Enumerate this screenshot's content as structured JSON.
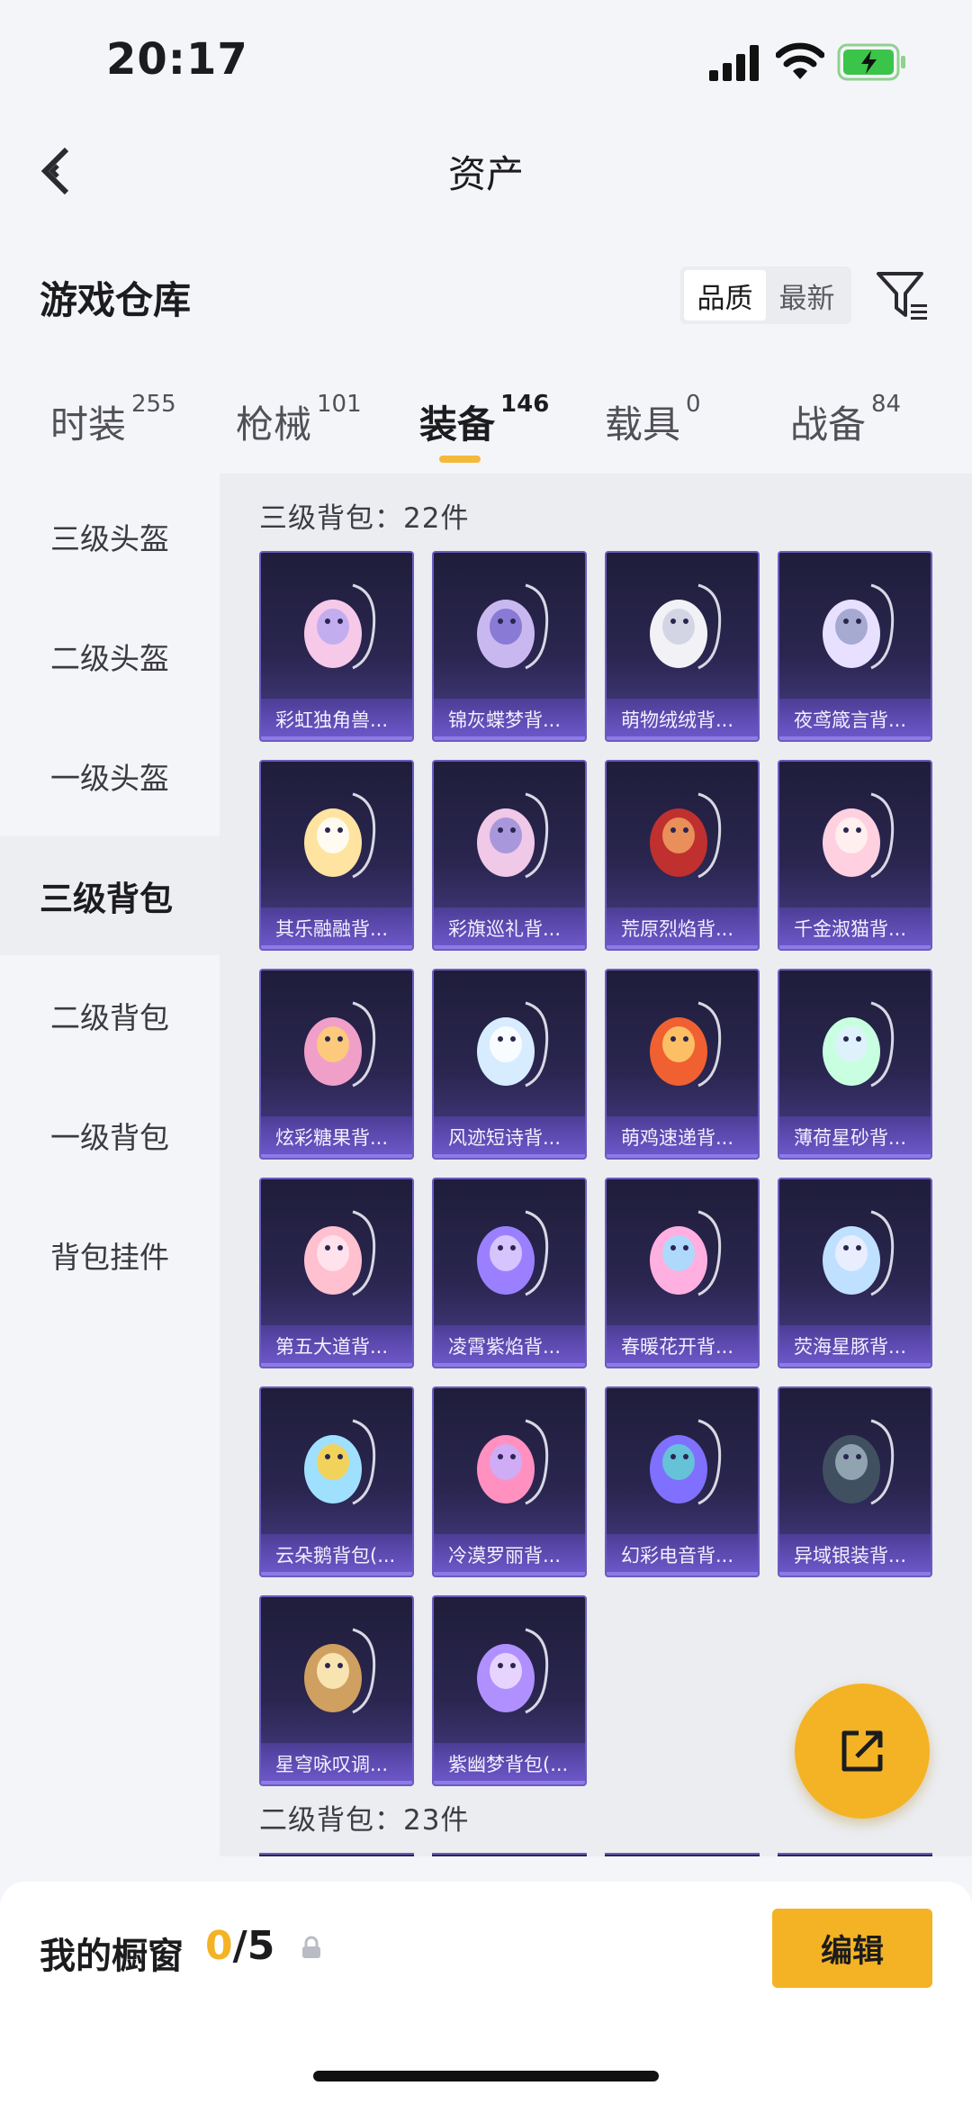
{
  "status": {
    "time": "20:17"
  },
  "nav": {
    "title": "资产"
  },
  "header": {
    "section_title": "游戏仓库",
    "sort_options": [
      "品质",
      "最新"
    ]
  },
  "tabs": [
    {
      "label": "时装",
      "count": "255"
    },
    {
      "label": "枪械",
      "count": "101"
    },
    {
      "label": "装备",
      "count": "146"
    },
    {
      "label": "载具",
      "count": "0"
    },
    {
      "label": "战备",
      "count": "84"
    }
  ],
  "sidebar": {
    "items": [
      "三级头盔",
      "二级头盔",
      "一级头盔",
      "三级背包",
      "二级背包",
      "一级背包",
      "背包挂件"
    ]
  },
  "groups": [
    {
      "title": "三级背包：22件"
    },
    {
      "title": "二级背包：23件"
    }
  ],
  "items": [
    {
      "name": "彩虹独角兽...",
      "icon": "unicorn-backpack-icon"
    },
    {
      "name": "锦灰蝶梦背...",
      "icon": "butterfly-backpack-icon"
    },
    {
      "name": "萌物绒绒背...",
      "icon": "plush-backpack-icon"
    },
    {
      "name": "夜鸢箴言背...",
      "icon": "kite-backpack-icon"
    },
    {
      "name": "其乐融融背...",
      "icon": "cupcake-backpack-icon"
    },
    {
      "name": "彩旗巡礼背...",
      "icon": "flag-backpack-icon"
    },
    {
      "name": "荒原烈焰背...",
      "icon": "flame-backpack-icon"
    },
    {
      "name": "千金淑猫背...",
      "icon": "cat-backpack-icon"
    },
    {
      "name": "炫彩糖果背...",
      "icon": "candy-backpack-icon"
    },
    {
      "name": "风迹短诗背...",
      "icon": "poem-backpack-icon"
    },
    {
      "name": "萌鸡速递背...",
      "icon": "chick-backpack-icon"
    },
    {
      "name": "薄荷星砂背...",
      "icon": "mint-backpack-icon"
    },
    {
      "name": "第五大道背...",
      "icon": "avenue-backpack-icon"
    },
    {
      "name": "凌霄紫焰背...",
      "icon": "purple-flame-backpack-icon"
    },
    {
      "name": "春暖花开背...",
      "icon": "spring-backpack-icon"
    },
    {
      "name": "荧海星豚背...",
      "icon": "dolphin-backpack-icon"
    },
    {
      "name": "云朵鹅背包(...",
      "icon": "goose-backpack-icon"
    },
    {
      "name": "冷漠罗丽背...",
      "icon": "heart-backpack-icon"
    },
    {
      "name": "幻彩电音背...",
      "icon": "speaker-backpack-icon"
    },
    {
      "name": "异域银装背...",
      "icon": "armor-backpack-icon"
    },
    {
      "name": "星穹咏叹调...",
      "icon": "aria-backpack-icon"
    },
    {
      "name": "紫幽梦背包(...",
      "icon": "violet-dream-backpack-icon"
    }
  ],
  "showcase": {
    "label": "我的橱窗",
    "current": "0",
    "total": "/5",
    "edit_label": "编辑"
  },
  "colors": {
    "accent": "#f4b324",
    "card_bg": "#2a2650",
    "card_border": "#6a5bc0"
  }
}
